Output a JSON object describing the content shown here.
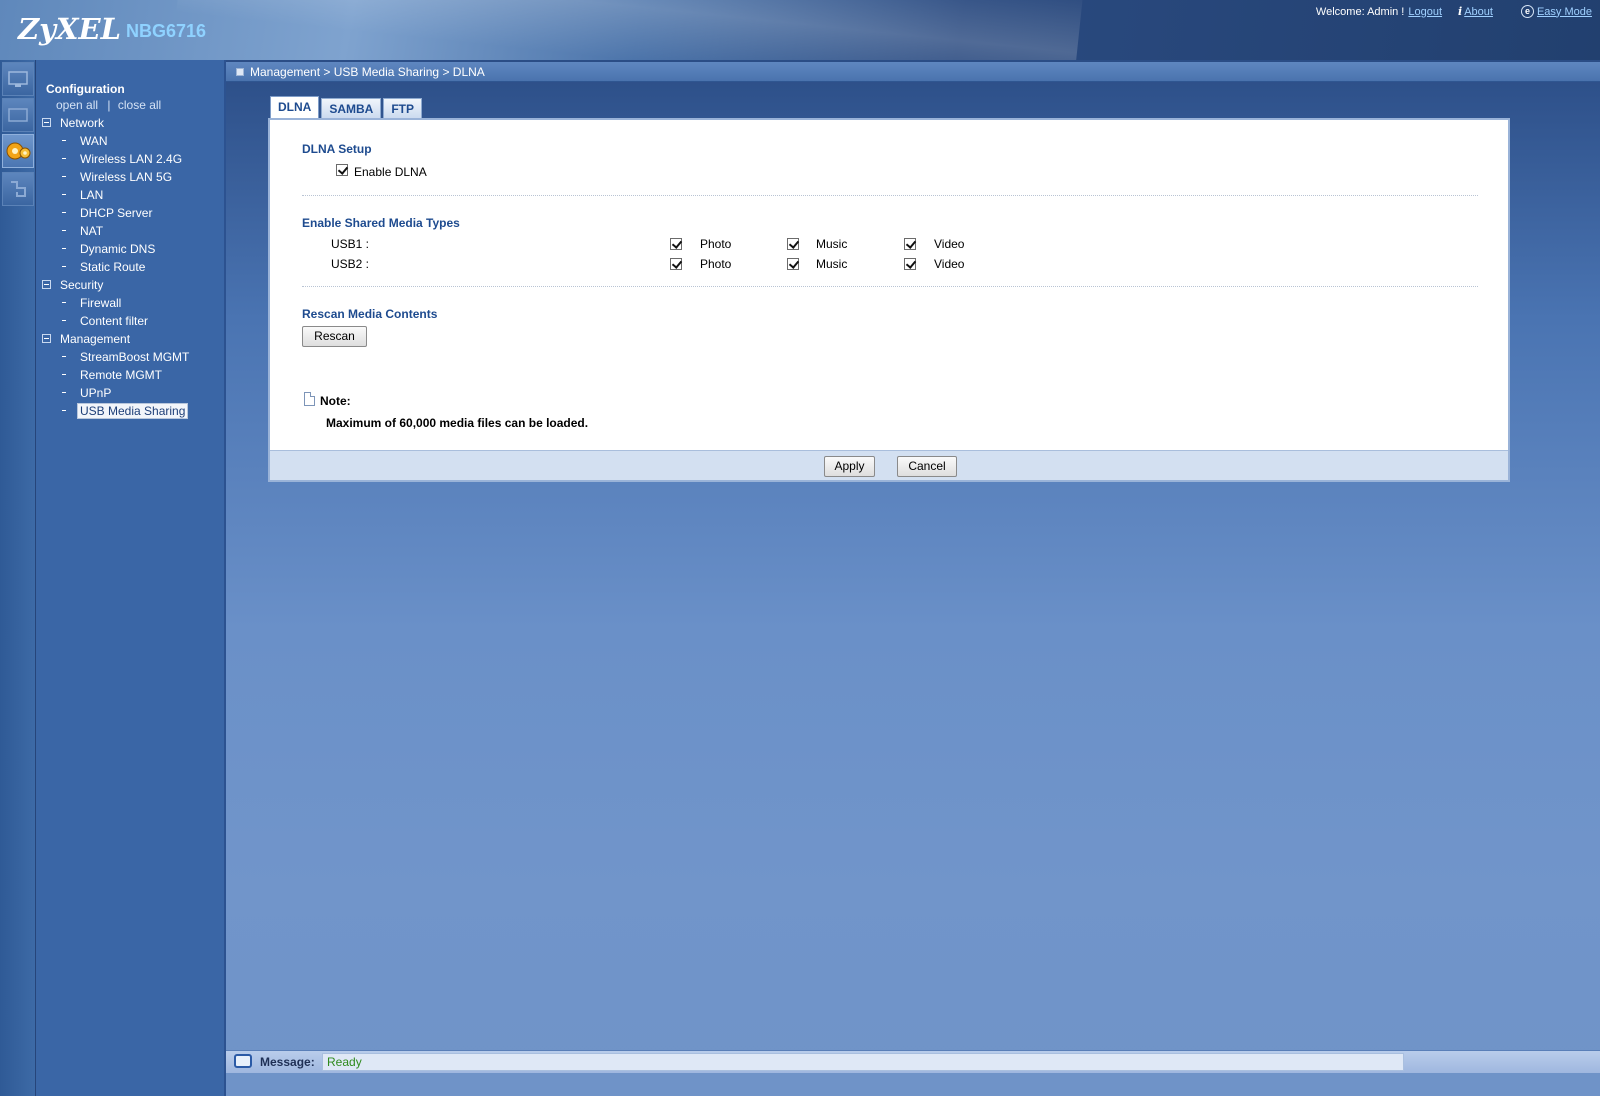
{
  "header": {
    "brand": "ZyXEL",
    "model": "NBG6716",
    "welcome_prefix": "Welcome: Admin !",
    "logout": "Logout",
    "about": "About",
    "easy_mode": "Easy Mode"
  },
  "nav": {
    "title": "Configuration",
    "open_all": "open all",
    "close_all": "close all",
    "groups": [
      {
        "label": "Network",
        "items": [
          "WAN",
          "Wireless LAN 2.4G",
          "Wireless LAN 5G",
          "LAN",
          "DHCP Server",
          "NAT",
          "Dynamic DNS",
          "Static Route"
        ]
      },
      {
        "label": "Security",
        "items": [
          "Firewall",
          "Content filter"
        ]
      },
      {
        "label": "Management",
        "items": [
          "StreamBoost MGMT",
          "Remote MGMT",
          "UPnP",
          "USB Media Sharing"
        ]
      }
    ],
    "selected": "USB Media Sharing"
  },
  "breadcrumb": "Management > USB Media Sharing > DLNA",
  "tabs": [
    "DLNA",
    "SAMBA",
    "FTP"
  ],
  "active_tab": "DLNA",
  "dlna_setup": {
    "title": "DLNA Setup",
    "enable_label": "Enable DLNA",
    "enabled": true
  },
  "media_types": {
    "title": "Enable Shared Media Types",
    "rows": [
      {
        "label": "USB1 :",
        "photo": "Photo",
        "music": "Music",
        "video": "Video",
        "photo_on": true,
        "music_on": true,
        "video_on": true
      },
      {
        "label": "USB2 :",
        "photo": "Photo",
        "music": "Music",
        "video": "Video",
        "photo_on": true,
        "music_on": true,
        "video_on": true
      }
    ]
  },
  "rescan": {
    "title": "Rescan Media Contents",
    "button": "Rescan"
  },
  "note": {
    "label": "Note:",
    "text": "Maximum of 60,000 media files can be loaded."
  },
  "buttons": {
    "apply": "Apply",
    "cancel": "Cancel"
  },
  "status": {
    "label": "Message:",
    "value": "Ready"
  },
  "colors": {
    "section_title": "#1e4b8f",
    "status_ready": "#2f8a1d"
  }
}
